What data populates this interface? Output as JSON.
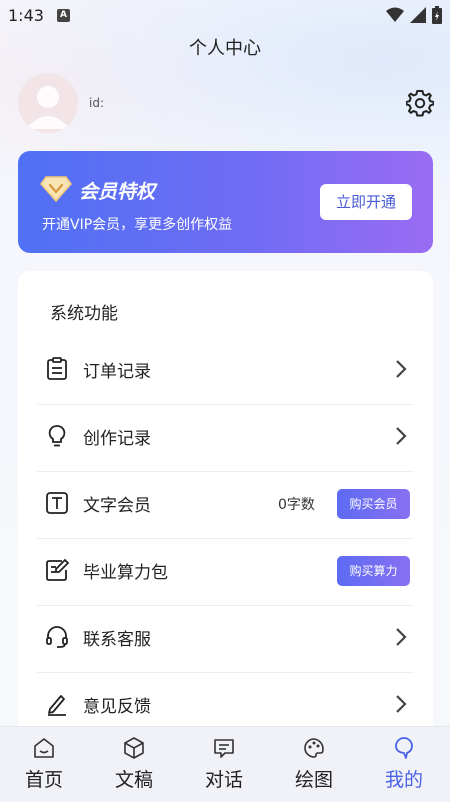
{
  "status_bar": {
    "time": "1:43",
    "app_icon_letter": "A"
  },
  "header": {
    "title": "个人中心"
  },
  "profile": {
    "id_label": "id:"
  },
  "vip_banner": {
    "title": "会员特权",
    "subtitle": "开通VIP会员，享更多创作权益",
    "button": "立即开通"
  },
  "system": {
    "heading": "系统功能",
    "items": [
      {
        "label": "订单记录",
        "icon": "clipboard-list-icon"
      },
      {
        "label": "创作记录",
        "icon": "lightbulb-icon"
      },
      {
        "label": "文字会员",
        "icon": "text-box-icon",
        "count": "0字数",
        "button": "购买会员"
      },
      {
        "label": "毕业算力包",
        "icon": "edit-note-icon",
        "button": "购买算力"
      },
      {
        "label": "联系客服",
        "icon": "headset-icon"
      },
      {
        "label": "意见反馈",
        "icon": "pen-icon"
      }
    ]
  },
  "bottom_nav": [
    {
      "label": "首页",
      "icon": "home-icon"
    },
    {
      "label": "文稿",
      "icon": "cube-icon"
    },
    {
      "label": "对话",
      "icon": "chat-icon"
    },
    {
      "label": "绘图",
      "icon": "palette-icon"
    },
    {
      "label": "我的",
      "icon": "profile-icon",
      "active": true
    }
  ],
  "colors": {
    "accent": "#4a62e8",
    "vip_start": "#4f71f5",
    "vip_end": "#9a6cf3"
  }
}
